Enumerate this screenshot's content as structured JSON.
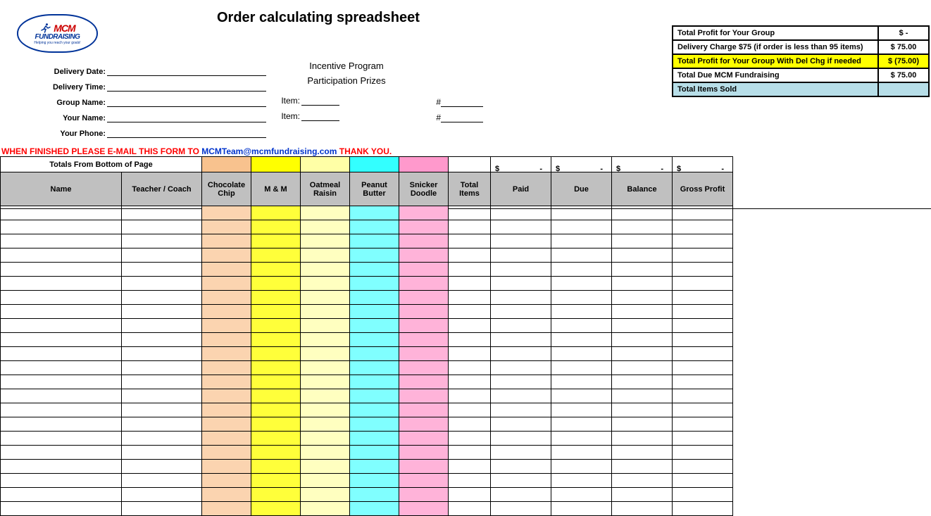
{
  "title": "Order calculating spreadsheet",
  "logo": {
    "brand1": "MCM",
    "brand2": "FUNDRAISING",
    "tag": "Helping you reach your goals!"
  },
  "form": {
    "delivery_date": "Delivery Date:",
    "delivery_time": "Delivery Time:",
    "group_name": "Group Name:",
    "your_name": "Your Name:",
    "your_phone": "Your Phone:"
  },
  "center": {
    "program": "Incentive Program",
    "prizes": "Participation Prizes",
    "item": "Item:",
    "hash": "#"
  },
  "footer": {
    "pre": "WHEN FINISHED PLEASE E-MAIL THIS FORM TO ",
    "email": "MCMTeam@mcmfundraising.com",
    "post": "  THANK  YOU."
  },
  "summary": [
    {
      "label": "Total Profit for Your Group",
      "value": "$           -",
      "cls": ""
    },
    {
      "label": "Delivery Charge $75 (if order is less than 95 items)",
      "value": "$       75.00",
      "cls": ""
    },
    {
      "label": "Total Profit for Your Group With Del Chg if needed",
      "value": "$     (75.00)",
      "cls": "y"
    },
    {
      "label": "Total Due MCM Fundraising",
      "value": "$       75.00",
      "cls": ""
    },
    {
      "label": "Total Items Sold",
      "value": "",
      "cls": "b"
    }
  ],
  "totals_label": "Totals From Bottom of Page",
  "headers": {
    "name": "Name",
    "teacher": "Teacher / Coach",
    "choc": "Chocolate Chip",
    "mm": "M & M",
    "oat": "Oatmeal Raisin",
    "pb": "Peanut Butter",
    "snick": "Snicker Doodle",
    "total": "Total Items",
    "paid": "Paid",
    "due": "Due",
    "balance": "Balance",
    "gross": "Gross Profit"
  },
  "money_placeholder": {
    "dollar": "$",
    "dash": "-"
  },
  "data_row_count": 22
}
